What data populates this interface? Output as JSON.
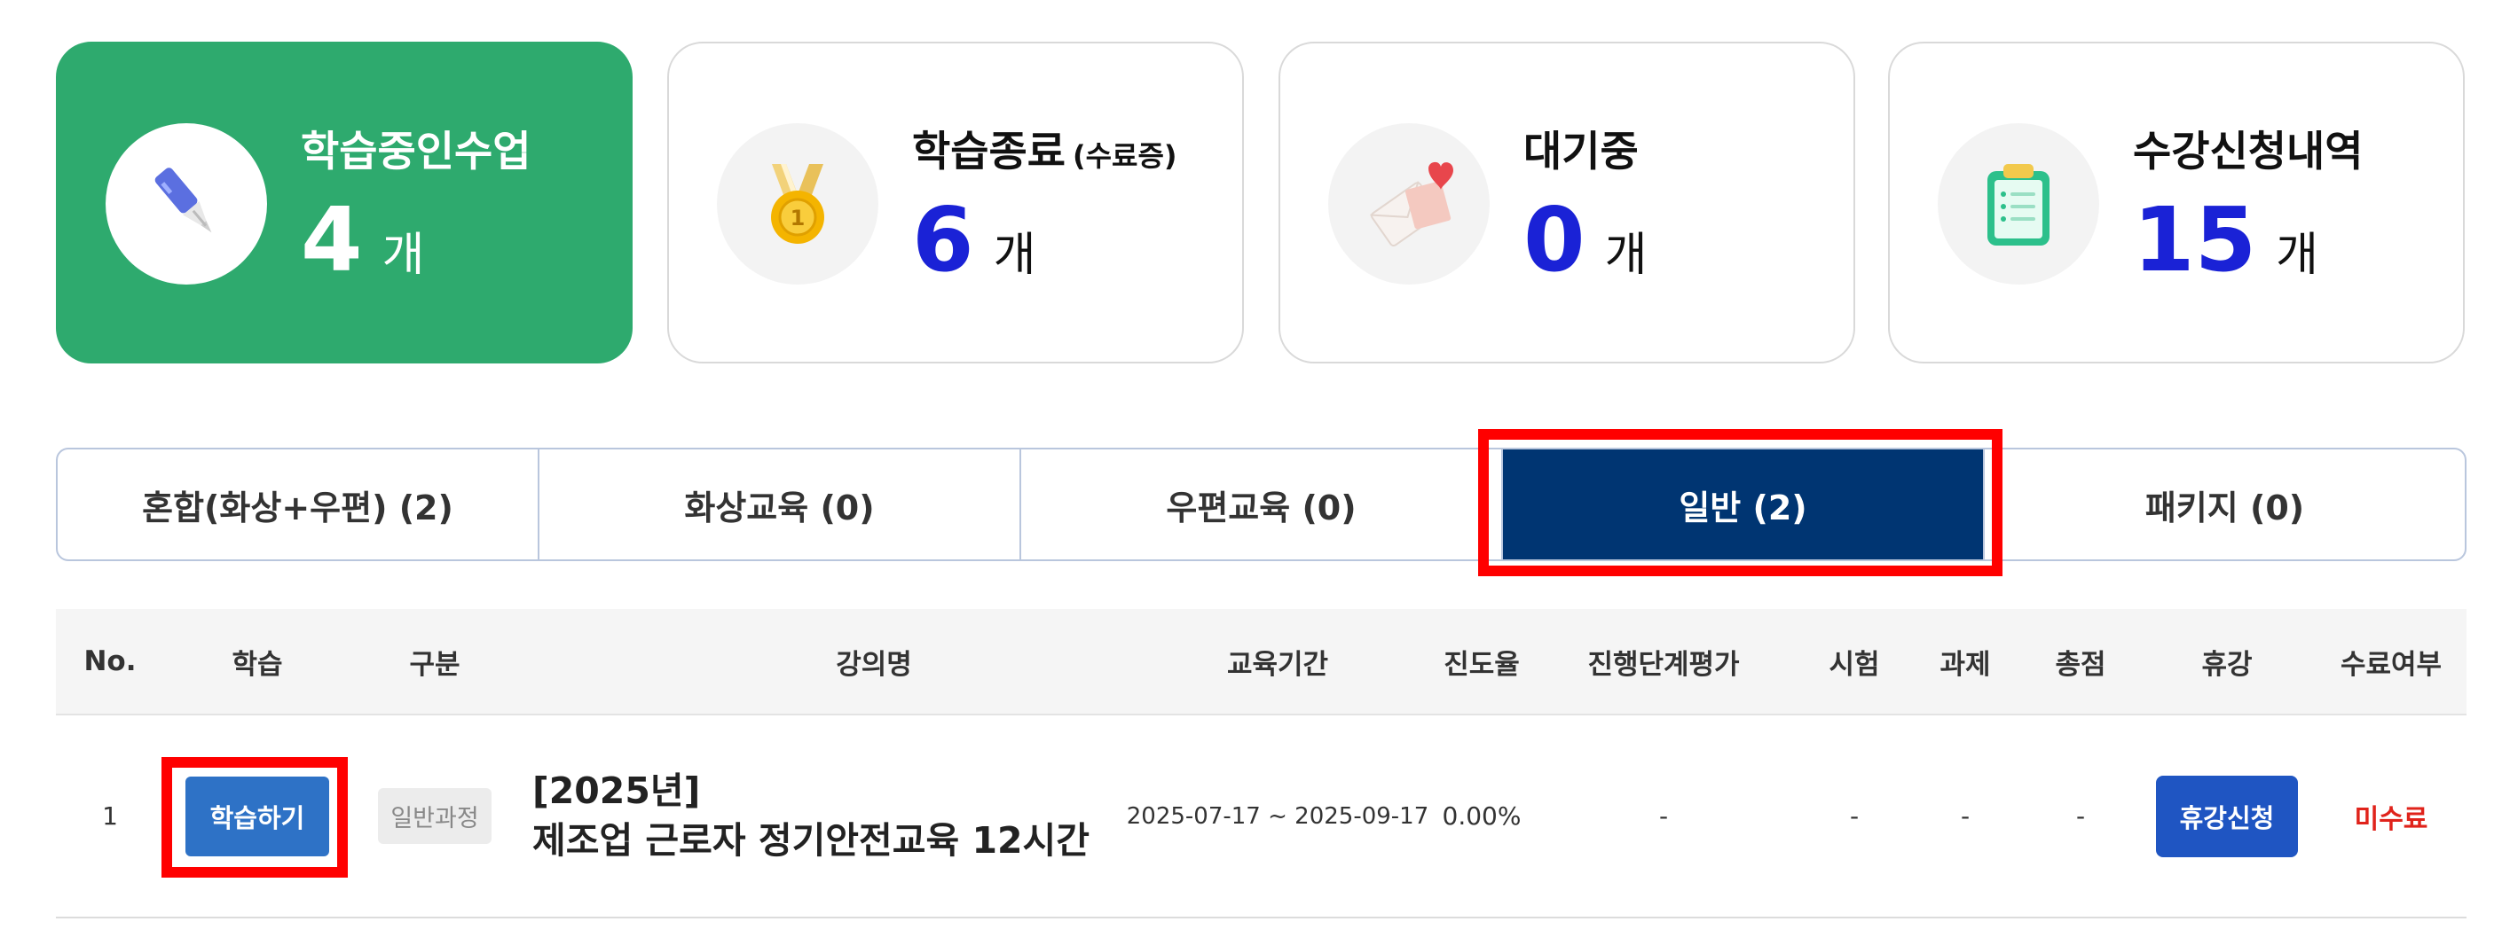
{
  "summary": [
    {
      "title": "학습중인수업",
      "sub": "",
      "count": "4",
      "unit": "개",
      "icon": "pen-icon"
    },
    {
      "title": "학습종료",
      "sub": "(수료증)",
      "count": "6",
      "unit": "개",
      "icon": "medal-icon"
    },
    {
      "title": "대기중",
      "sub": "",
      "count": "0",
      "unit": "개",
      "icon": "envelope-heart-icon"
    },
    {
      "title": "수강신청내역",
      "sub": "",
      "count": "15",
      "unit": "개",
      "icon": "clipboard-icon"
    }
  ],
  "tabs": [
    "혼합(화상+우편) (2)",
    "화상교육 (0)",
    "우편교육 (0)",
    "일반 (2)",
    "패키지 (0)"
  ],
  "active_tab": "일반 (2)",
  "table": {
    "headers": [
      "No.",
      "학습",
      "구분",
      "강의명",
      "교육기간",
      "진도율",
      "진행단계평가",
      "시험",
      "과제",
      "총점",
      "휴강",
      "수료여부"
    ],
    "rows": [
      {
        "no": "1",
        "study_button": "학습하기",
        "category": "일반과정",
        "title_line1": "[2025년]",
        "title_line2": "제조업 근로자 정기안전교육 12시간",
        "period": "2025-07-17 ~ 2025-09-17",
        "progress": "0.00%",
        "stage_eval": "-",
        "exam": "-",
        "assignment": "-",
        "total": "-",
        "leave_button": "휴강신청",
        "completion": "미수료"
      }
    ]
  },
  "colors": {
    "active_card": "#2eaa6e",
    "count_blue": "#1a22d6",
    "tab_active": "#003572",
    "study_button": "#2e72c6",
    "leave_button": "#1f55c2",
    "status_red": "#e0231b",
    "highlight": "#ff0000"
  }
}
